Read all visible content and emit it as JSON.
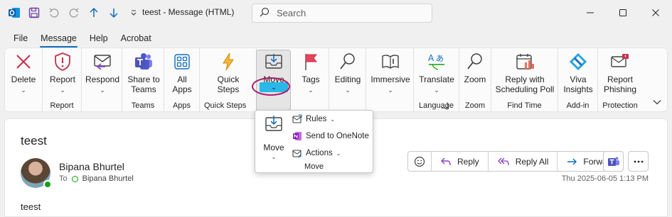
{
  "titlebar": {
    "title": "teest  -  Message (HTML)",
    "search_placeholder": "Search"
  },
  "menu_tabs": [
    "File",
    "Message",
    "Help",
    "Acrobat"
  ],
  "active_tab": "Message",
  "ribbon": {
    "delete": "Delete",
    "report": "Report",
    "respond": "Respond",
    "share_to_teams": "Share to Teams",
    "all_apps": "All Apps",
    "quick_steps": "Quick Steps",
    "move": "Move",
    "tags": "Tags",
    "editing": "Editing",
    "immersive": "Immersive",
    "translate": "Translate",
    "zoom": "Zoom",
    "reply_with_scheduling_poll": "Reply with Scheduling Poll",
    "viva_insights": "Viva Insights",
    "report_phishing": "Report Phishing",
    "groups": {
      "report": "Report",
      "teams": "Teams",
      "apps": "Apps",
      "quick_steps": "Quick Steps",
      "language": "Language",
      "zoom": "Zoom",
      "find_time": "Find Time",
      "add_in": "Add-in",
      "protection": "Protection"
    }
  },
  "move_dropdown": {
    "move": "Move",
    "rules": "Rules",
    "send_to_onenote": "Send to OneNote",
    "actions": "Actions",
    "group_name": "Move"
  },
  "message": {
    "subject": "teest",
    "sender": "Bipana Bhurtel",
    "to_label": "To",
    "recipient": "Bipana Bhurtel",
    "date": "Thu 2025-06-05 1:13 PM",
    "body": "teest",
    "actions": {
      "reply": "Reply",
      "reply_all": "Reply All",
      "forward": "Forward"
    }
  },
  "colors": {
    "accent": "#0f6cbd",
    "delete_red": "#c4314b",
    "move_highlight": "#29b8e8",
    "annotation_magenta": "#b0176b",
    "presence_green": "#13a10e"
  }
}
